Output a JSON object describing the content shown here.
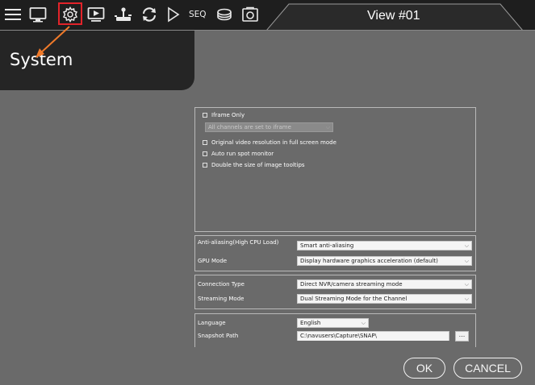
{
  "toolbar": {
    "icons": [
      "menu-icon",
      "monitor-icon",
      "gear-icon",
      "playback-icon",
      "joystick-icon",
      "sync-icon",
      "play-icon",
      "seq-label",
      "storage-icon",
      "snapshot-icon"
    ],
    "seq_label": "SEQ",
    "highlight_color": "#e2232a"
  },
  "view_tab": {
    "label": "View #01"
  },
  "system_panel": {
    "title": "System"
  },
  "general_options": {
    "iframe_only": {
      "label": "Iframe Only",
      "checked": false
    },
    "iframe_select": {
      "value": "All channels are set to iframe",
      "enabled": false
    },
    "original_resolution": {
      "label": "Original video resolution in full screen mode",
      "checked": false
    },
    "auto_run_spot": {
      "label": "Auto run spot monitor",
      "checked": false
    },
    "double_tooltips": {
      "label": "Double the size of image tooltips",
      "checked": false
    }
  },
  "render_settings": {
    "anti_aliasing": {
      "label": "Anti-aliasing(High CPU Load)",
      "value": "Smart anti-aliasing"
    },
    "gpu_mode": {
      "label": "GPU Mode",
      "value": "Display hardware graphics acceleration (default)"
    }
  },
  "connection_settings": {
    "connection_type": {
      "label": "Connection Type",
      "value": "Direct NVR/camera streaming mode"
    },
    "streaming_mode": {
      "label": "Streaming Mode",
      "value": "Dual Streaming Mode for the Channel"
    }
  },
  "misc_settings": {
    "language": {
      "label": "Language",
      "value": "English"
    },
    "snapshot_path": {
      "label": "Snapshot Path",
      "value": "C:\\navusers\\Capture\\SNAP\\"
    },
    "browse_label": "..."
  },
  "footer": {
    "ok_label": "OK",
    "cancel_label": "CANCEL"
  },
  "annotation": {
    "arrow_color": "#f07a2a"
  }
}
